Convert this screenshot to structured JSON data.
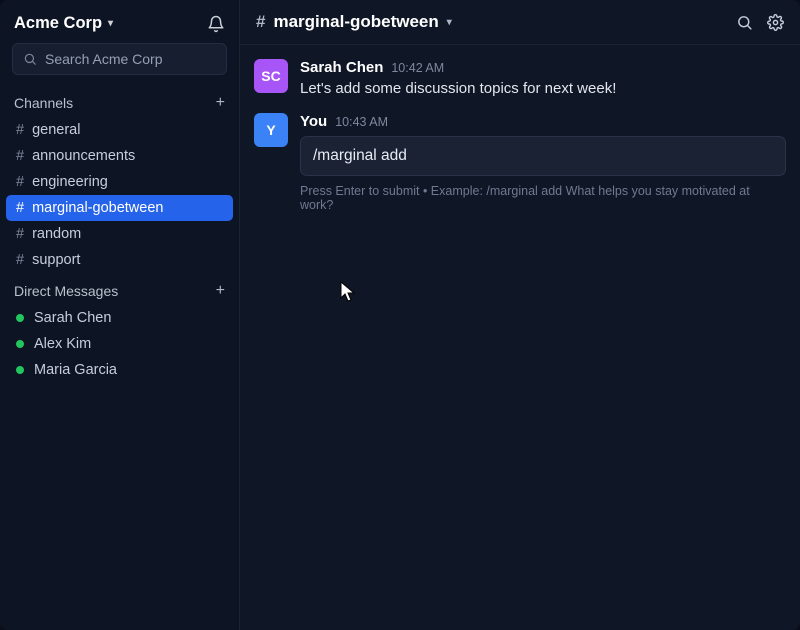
{
  "workspace": {
    "name": "Acme Corp"
  },
  "search": {
    "placeholder": "Search Acme Corp"
  },
  "sidebar": {
    "channels_label": "Channels",
    "dms_label": "Direct Messages",
    "channels": [
      {
        "name": "general",
        "active": false
      },
      {
        "name": "announcements",
        "active": false
      },
      {
        "name": "engineering",
        "active": false
      },
      {
        "name": "marginal-gobetween",
        "active": true
      },
      {
        "name": "random",
        "active": false
      },
      {
        "name": "support",
        "active": false
      }
    ],
    "dms": [
      {
        "name": "Sarah Chen",
        "online": true
      },
      {
        "name": "Alex Kim",
        "online": true
      },
      {
        "name": "Maria Garcia",
        "online": true
      }
    ]
  },
  "header": {
    "channel": "marginal-gobetween"
  },
  "messages": [
    {
      "avatar_initials": "SC",
      "avatar_color": "#a855f7",
      "author": "Sarah Chen",
      "time": "10:42 AM",
      "text": "Let's add some discussion topics for next week!"
    },
    {
      "avatar_initials": "Y",
      "avatar_color": "#3b82f6",
      "author": "You",
      "time": "10:43 AM",
      "command_input": "/marginal add",
      "hint": "Press Enter to submit • Example: /marginal add What helps you stay motivated at work?"
    }
  ],
  "icons": {
    "bell": "bell-icon",
    "search": "search-icon",
    "plus": "plus-icon",
    "gear": "gear-icon",
    "chevron_down": "chevron-down-icon",
    "hash": "hash-icon"
  }
}
